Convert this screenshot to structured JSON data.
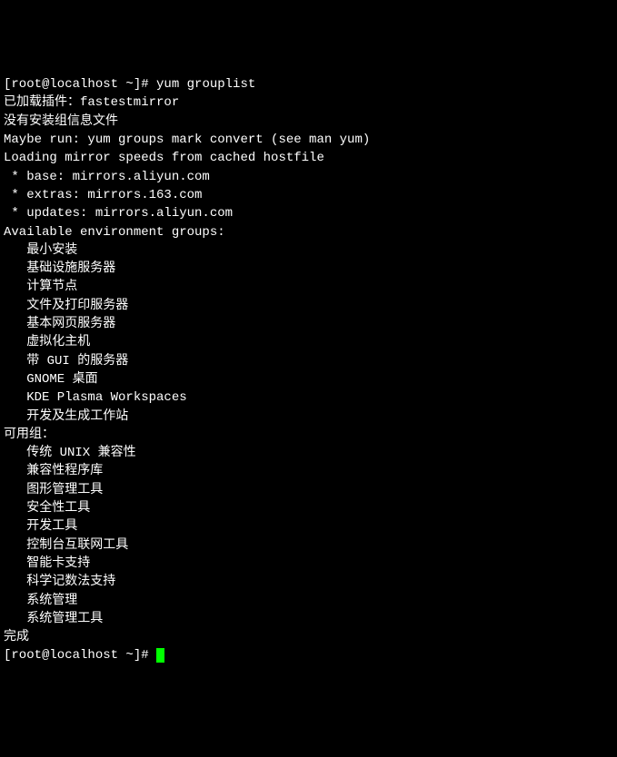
{
  "terminal": {
    "prompt1": "[root@localhost ~]# ",
    "command": "yum grouplist",
    "line_plugin": "已加载插件：fastestmirror",
    "line_no_info": "没有安装组信息文件",
    "line_maybe_run": "Maybe run: yum groups mark convert (see man yum)",
    "line_loading": "Loading mirror speeds from cached hostfile",
    "mirror_base": " * base: mirrors.aliyun.com",
    "mirror_extras": " * extras: mirrors.163.com",
    "mirror_updates": " * updates: mirrors.aliyun.com",
    "env_header": "Available environment groups:",
    "env_items": [
      "   最小安装",
      "   基础设施服务器",
      "   计算节点",
      "   文件及打印服务器",
      "   基本网页服务器",
      "   虚拟化主机",
      "   带 GUI 的服务器",
      "   GNOME 桌面",
      "   KDE Plasma Workspaces",
      "   开发及生成工作站"
    ],
    "avail_header": "可用组：",
    "avail_items": [
      "   传统 UNIX 兼容性",
      "   兼容性程序库",
      "   图形管理工具",
      "   安全性工具",
      "   开发工具",
      "   控制台互联网工具",
      "   智能卡支持",
      "   科学记数法支持",
      "   系统管理",
      "   系统管理工具"
    ],
    "done": "完成",
    "prompt2": "[root@localhost ~]# "
  }
}
